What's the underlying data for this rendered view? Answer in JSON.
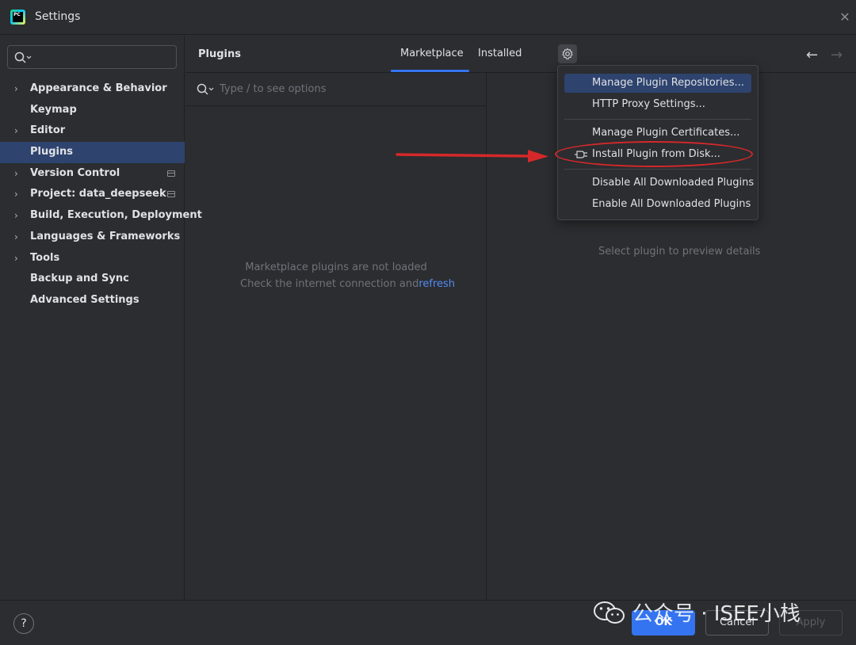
{
  "window": {
    "title": "Settings",
    "close_icon": "close-icon"
  },
  "sidebar": {
    "search_placeholder": "",
    "items": [
      {
        "label": "Appearance & Behavior",
        "expandable": true
      },
      {
        "label": "Keymap",
        "expandable": false
      },
      {
        "label": "Editor",
        "expandable": true
      },
      {
        "label": "Plugins",
        "expandable": false,
        "selected": true
      },
      {
        "label": "Version Control",
        "expandable": true,
        "project_icon": true
      },
      {
        "label": "Project: data_deepseek",
        "expandable": true,
        "project_icon": true
      },
      {
        "label": "Build, Execution, Deployment",
        "expandable": true
      },
      {
        "label": "Languages & Frameworks",
        "expandable": true
      },
      {
        "label": "Tools",
        "expandable": true
      },
      {
        "label": "Backup and Sync",
        "expandable": false
      },
      {
        "label": "Advanced Settings",
        "expandable": false
      }
    ]
  },
  "header": {
    "title": "Plugins",
    "tabs": [
      {
        "label": "Marketplace",
        "active": true
      },
      {
        "label": "Installed",
        "active": false
      }
    ]
  },
  "list_pane": {
    "search_placeholder": "Type / to see options",
    "message_line1": "Marketplace plugins are not loaded",
    "message_line2": "Check the internet connection and",
    "refresh_link": "refresh"
  },
  "preview": {
    "message": "Select plugin to preview details"
  },
  "gear_menu": {
    "items": [
      {
        "label": "Manage Plugin Repositories...",
        "highlighted": true
      },
      {
        "label": "HTTP Proxy Settings..."
      },
      {
        "label": "Manage Plugin Certificates..."
      },
      {
        "label": "Install Plugin from Disk...",
        "icon": "plug-icon"
      },
      {
        "label": "Disable All Downloaded Plugins"
      },
      {
        "label": "Enable All Downloaded Plugins"
      }
    ]
  },
  "footer": {
    "help_label": "?",
    "ok_label": "OK",
    "cancel_label": "Cancel",
    "apply_label": "Apply"
  },
  "watermark": {
    "text": "公众号 · ISEE小栈"
  },
  "colors": {
    "background": "#2b2d30",
    "selection": "#2e436e",
    "accent": "#3574f0",
    "annotation": "#d6282a"
  }
}
